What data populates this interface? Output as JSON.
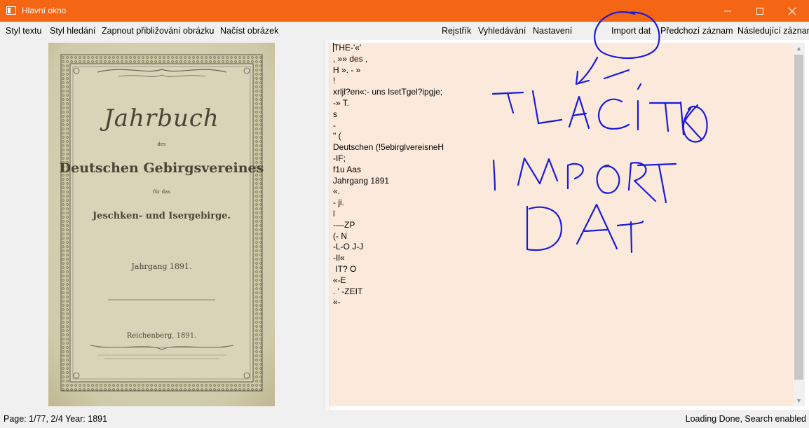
{
  "window": {
    "title": "Hlavní okno"
  },
  "menu": {
    "left": [
      "Styl textu",
      "Styl hledání",
      "Zapnout přibližování obrázku",
      "Načíst obrázek"
    ],
    "right": [
      "Rejstřík",
      "Vyhledávání",
      "Nastavení",
      "Import dat",
      "Předchozí záznam",
      "Následující záznam"
    ]
  },
  "cover": {
    "title": "Jahrbuch",
    "small1": "des",
    "main": "Deutschen Gebirgsvereines",
    "small2": "für das",
    "region": "Jeschken- und Isergebirge.",
    "year": "Jahrgang 1891.",
    "place": "Reichenberg, 1891."
  },
  "ocr_lines": [
    "THE-'«'",
    ", »» des ,",
    "H ». - »",
    "!",
    "xrljl?en«:- uns IsetTgel?ipgje;",
    "-» T.",
    "s",
    "-",
    "\" (",
    "Deutschen (!5ebirglvereisneH",
    "-IF;",
    "f1u Aas",
    "Jahrgang 1891",
    "«.",
    "- ji.",
    "l",
    "-—ZP",
    "(- N",
    "-L-O J-J",
    "-Il«",
    " IT? O",
    "«-E",
    ". ' -ZEIT",
    "«-"
  ],
  "annotation": {
    "line1": "TLAČÍTKO",
    "line2": "IMPORT",
    "line3": "DAT",
    "color": "#1a1adc"
  },
  "status": {
    "left": "Page: 1/77, 2/4  Year: 1891",
    "right": "Loading Done, Search enabled"
  },
  "colors": {
    "titlebar": "#f56614",
    "text_background": "#fbeadb",
    "chrome": "#f0f0f0"
  }
}
